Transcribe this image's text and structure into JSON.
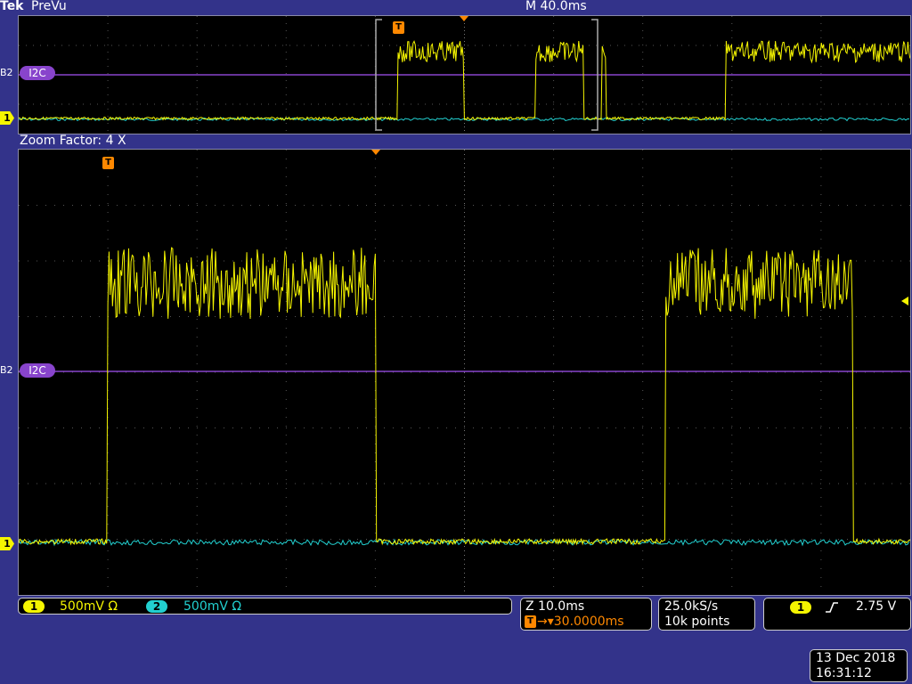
{
  "header": {
    "brand": "Tek",
    "status": "PreVu",
    "timebase": "M 40.0ms"
  },
  "zoom_label": "Zoom Factor: 4 X",
  "markers": {
    "ch1": "1",
    "bus_ref": "B2",
    "bus_name": "I2C",
    "trigger": "T"
  },
  "channels": [
    {
      "chip": "1",
      "scale": "500mV Ω",
      "color": "#f5f500"
    },
    {
      "chip": "2",
      "scale": "500mV Ω",
      "color": "#22d0d0"
    }
  ],
  "zoom_readout": {
    "scale": "Z 10.0ms",
    "position": "→▾30.0000ms"
  },
  "acquisition": {
    "sample_rate": "25.0kS/s",
    "record_length": "10k points"
  },
  "trigger": {
    "source": "1",
    "slope": "rising-edge-icon",
    "level": "2.75 V"
  },
  "datetime": {
    "date": "13 Dec 2018",
    "time": "16:31:12"
  },
  "colors": {
    "ch1": "#f5f500",
    "ch2": "#22d0d0",
    "bus": "#8844cc",
    "trigger": "#ff8800",
    "background": "#33338a"
  }
}
